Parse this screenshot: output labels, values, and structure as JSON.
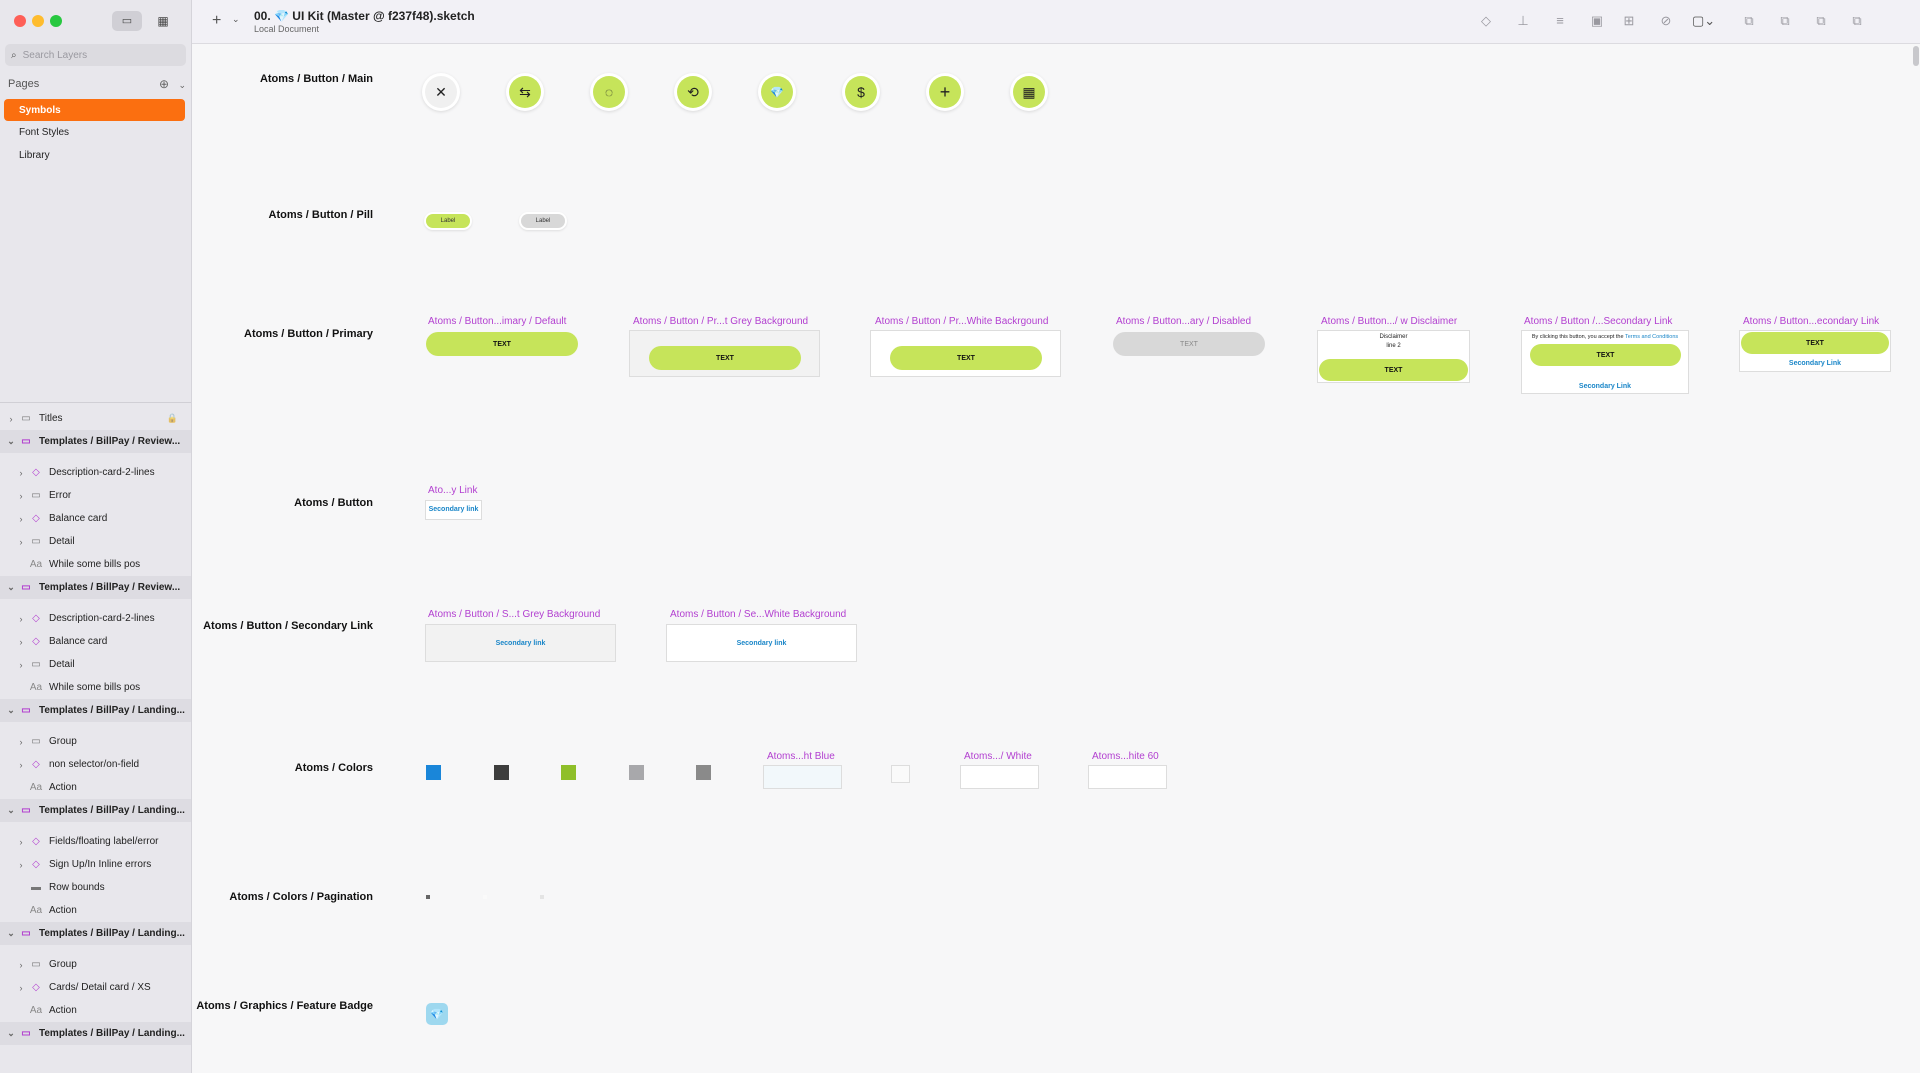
{
  "window": {
    "title": "00. 💎 UI Kit (Master @ f237f48).sketch",
    "subtitle": "Local Document"
  },
  "sidebar": {
    "search_placeholder": "Search Layers",
    "pages_label": "Pages",
    "pages": [
      "Symbols",
      "Font Styles",
      "Library"
    ],
    "layers": [
      {
        "label": "Titles",
        "type": "folder",
        "level": 0,
        "expanded": false
      },
      {
        "label": "Templates / BillPay / Review...",
        "type": "artboard",
        "level": 0,
        "expanded": true
      },
      {
        "label": "Description-card-2-lines",
        "type": "symbol",
        "level": 1
      },
      {
        "label": "Error",
        "type": "folder",
        "level": 1
      },
      {
        "label": "Balance card",
        "type": "symbol",
        "level": 1
      },
      {
        "label": "Detail",
        "type": "folder",
        "level": 1
      },
      {
        "label": "While some bills pos",
        "type": "text",
        "level": 1
      },
      {
        "label": "Templates / BillPay / Review...",
        "type": "artboard",
        "level": 0,
        "expanded": true
      },
      {
        "label": "Description-card-2-lines",
        "type": "symbol",
        "level": 1
      },
      {
        "label": "Balance card",
        "type": "symbol",
        "level": 1
      },
      {
        "label": "Detail",
        "type": "folder",
        "level": 1
      },
      {
        "label": "While some bills pos",
        "type": "text",
        "level": 1
      },
      {
        "label": "Templates / BillPay / Landing...",
        "type": "artboard",
        "level": 0,
        "expanded": true
      },
      {
        "label": "Group",
        "type": "folder",
        "level": 1
      },
      {
        "label": "non selector/on-field",
        "type": "symbol",
        "level": 1
      },
      {
        "label": "Action",
        "type": "text",
        "level": 1
      },
      {
        "label": "Templates / BillPay / Landing...",
        "type": "artboard",
        "level": 0,
        "expanded": true
      },
      {
        "label": "Fields/floating label/error",
        "type": "symbol",
        "level": 1
      },
      {
        "label": "Sign Up/In Inline errors",
        "type": "symbol",
        "level": 1
      },
      {
        "label": "Row bounds",
        "type": "rect",
        "level": 1
      },
      {
        "label": "Action",
        "type": "text",
        "level": 1
      },
      {
        "label": "Templates / BillPay / Landing...",
        "type": "artboard",
        "level": 0,
        "expanded": true
      },
      {
        "label": "Group",
        "type": "folder",
        "level": 1
      },
      {
        "label": "Cards/ Detail card / XS",
        "type": "symbol",
        "level": 1
      },
      {
        "label": "Action",
        "type": "text",
        "level": 1
      },
      {
        "label": "Templates / BillPay / Landing...",
        "type": "artboard",
        "level": 0,
        "expanded": true
      }
    ]
  },
  "canvas": {
    "rows": [
      "Atoms / Button / Main",
      "Atoms / Button / Pill",
      "Atoms / Button / Primary",
      "Atoms / Button",
      "Atoms / Button / Secondary Link",
      "Atoms / Colors",
      "Atoms / Colors / Pagination",
      "Atoms / Graphics /  Feature Badge"
    ],
    "main_buttons": [
      "✕",
      "⇆",
      "◌",
      "⟲",
      "💎",
      "$",
      "+",
      "▦"
    ],
    "pills": [
      "Label",
      "Label"
    ],
    "primary": {
      "names": [
        "Atoms / Button...imary / Default",
        "Atoms / Button / Pr...t Grey Background",
        "Atoms / Button / Pr...White Backrgound",
        "Atoms / Button...ary / Disabled",
        "Atoms / Button.../ w Disclaimer",
        "Atoms / Button /...Secondary Link",
        "Atoms / Button...econdary Link"
      ],
      "button_text": "TEXT",
      "disclaimer_line1": "Disclaimer",
      "disclaimer_line2": "line 2",
      "terms_prefix": "By clicking this button, you accept the ",
      "terms_link": "Terms and Conditions",
      "secondary_link": "Secondary Link"
    },
    "button_link": {
      "name": "Ato...y Link",
      "text": "Secondary link"
    },
    "secondary": {
      "names": [
        "Atoms / Button / S...t Grey Background",
        "Atoms / Button / Se...White Background"
      ],
      "text": "Secondary link"
    },
    "colors": {
      "swatches": [
        "#1a86d9",
        "#3d3d3d",
        "#8fbf2a",
        "#a8a8ab",
        "#8a8a8a"
      ],
      "names": [
        "Atoms...ht Blue",
        "Atoms.../ White",
        "Atoms...hite 60"
      ]
    },
    "accent": "#c6e45a",
    "symbol_name_color": "#b23fd0"
  }
}
